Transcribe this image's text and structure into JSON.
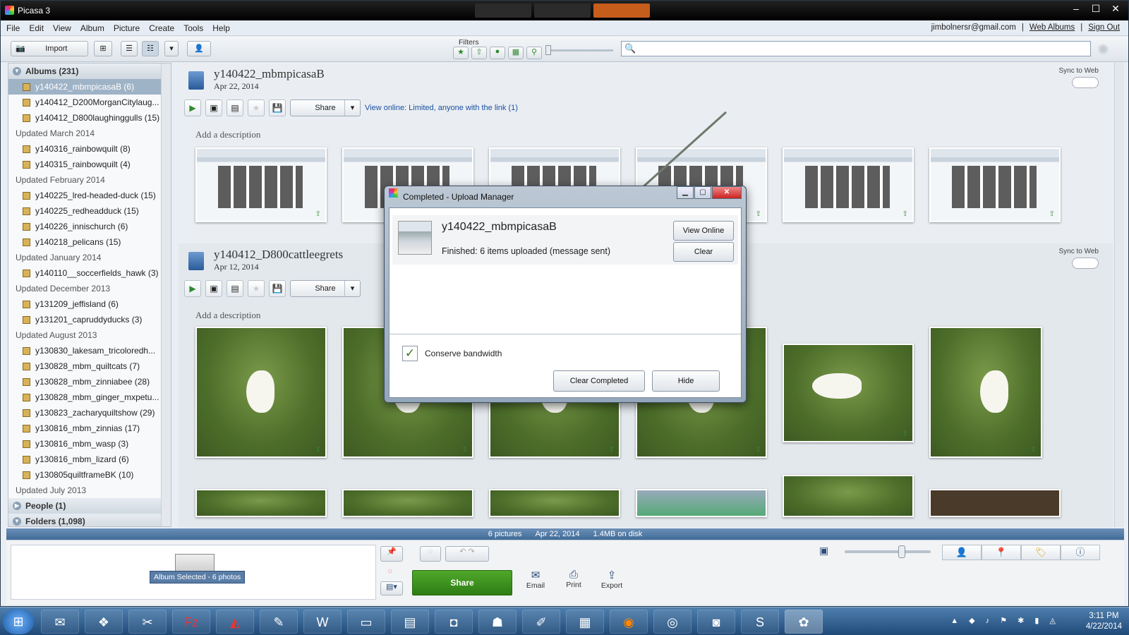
{
  "window": {
    "title": "Picasa 3",
    "controls": {
      "min": "–",
      "max": "☐",
      "close": "✕"
    }
  },
  "menu": {
    "items": [
      "File",
      "Edit",
      "View",
      "Album",
      "Picture",
      "Create",
      "Tools",
      "Help"
    ],
    "email": "jimbolnersr@gmail.com",
    "web_albums": "Web Albums",
    "sign_out": "Sign Out",
    "sep": "|"
  },
  "toolbar": {
    "import": "Import",
    "filters": "Filters",
    "search_placeholder": ""
  },
  "sidebar": {
    "albums_header": "Albums (231)",
    "rows": [
      {
        "kind": "item",
        "label": "y140422_mbmpicasaB (6)",
        "sel": true
      },
      {
        "kind": "item",
        "label": "y140412_D200MorganCitylaug..."
      },
      {
        "kind": "item",
        "label": "y140412_D800laughinggulls (15)"
      },
      {
        "kind": "hdr",
        "label": "Updated March 2014"
      },
      {
        "kind": "item",
        "label": "y140316_rainbowquilt (8)"
      },
      {
        "kind": "item",
        "label": "y140315_rainbowquilt (4)"
      },
      {
        "kind": "hdr",
        "label": "Updated February 2014"
      },
      {
        "kind": "item",
        "label": "y140225_lred-headed-duck (15)"
      },
      {
        "kind": "item",
        "label": "y140225_redheadduck (15)"
      },
      {
        "kind": "item",
        "label": "y140226_innischurch (6)"
      },
      {
        "kind": "item",
        "label": "y140218_pelicans (15)"
      },
      {
        "kind": "hdr",
        "label": "Updated January 2014"
      },
      {
        "kind": "item",
        "label": "y140110__soccerfields_hawk (3)"
      },
      {
        "kind": "hdr",
        "label": "Updated December 2013"
      },
      {
        "kind": "item",
        "label": "y131209_jeffisland (6)"
      },
      {
        "kind": "item",
        "label": "y131201_capruddyducks (3)"
      },
      {
        "kind": "hdr",
        "label": "Updated August 2013"
      },
      {
        "kind": "item",
        "label": "y130830_lakesam_tricoloredh..."
      },
      {
        "kind": "item",
        "label": "y130828_mbm_quiltcats (7)"
      },
      {
        "kind": "item",
        "label": "y130828_mbm_zinniabee (28)"
      },
      {
        "kind": "item",
        "label": "y130828_mbm_ginger_mxpetu..."
      },
      {
        "kind": "item",
        "label": "y130823_zacharyquiltshow (29)"
      },
      {
        "kind": "item",
        "label": "y130816_mbm_zinnias (17)"
      },
      {
        "kind": "item",
        "label": "y130816_mbm_wasp (3)"
      },
      {
        "kind": "item",
        "label": "y130816_mbm_lizard (6)"
      },
      {
        "kind": "item",
        "label": "y130805quiltframeBK (10)"
      },
      {
        "kind": "hdr",
        "label": "Updated July 2013"
      }
    ],
    "people": "People (1)",
    "folders": "Folders (1,098)"
  },
  "albums": [
    {
      "title": "y140422_mbmpicasaB",
      "date": "Apr 22, 2014",
      "sync": "Sync to Web",
      "share": "Share",
      "view_online": "View online: Limited, anyone with the link (1)",
      "desc": "Add a description"
    },
    {
      "title": "y140412_D800cattleegrets",
      "date": "Apr 12, 2014",
      "sync": "Sync to Web",
      "share": "Share",
      "desc": "Add a description"
    }
  ],
  "status": {
    "pictures": "6 pictures",
    "date": "Apr 22, 2014",
    "size": "1.4MB on disk"
  },
  "bottom": {
    "album_selected": "Album Selected - 6 photos",
    "share": "Share",
    "email": "Email",
    "print": "Print",
    "export": "Export"
  },
  "dialog": {
    "title": "Completed - Upload Manager",
    "album": "y140422_mbmpicasaB",
    "message": "Finished: 6 items uploaded (message sent)",
    "view_online": "View Online",
    "clear": "Clear",
    "conserve": "Conserve bandwidth",
    "clear_completed": "Clear Completed",
    "hide": "Hide"
  },
  "taskbar": {
    "time": "3:11 PM",
    "date": "4/22/2014"
  },
  "colors": {
    "share_green": "#3a9120",
    "status_blue": "#4f79a6",
    "accent_orange": "#c75d1b"
  }
}
